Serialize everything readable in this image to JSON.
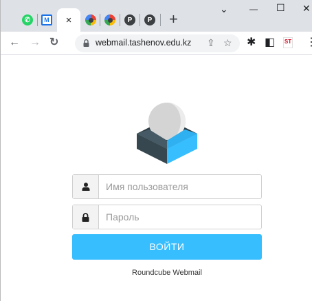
{
  "browser": {
    "tabs": [
      {
        "icon": "whatsapp-icon",
        "glyph": "✆"
      },
      {
        "icon": "mail-icon",
        "glyph": "M",
        "active": false
      },
      {
        "icon": "close-tab-icon",
        "glyph": "×",
        "active": true
      },
      {
        "icon": "round-favicon-icon",
        "glyph": ""
      },
      {
        "icon": "round-favicon-icon",
        "glyph": ""
      },
      {
        "icon": "p-favicon-icon",
        "glyph": "P"
      },
      {
        "icon": "p-favicon-icon",
        "glyph": "P"
      }
    ],
    "new_tab_glyph": "+",
    "window_controls": {
      "dropdown": "⌄",
      "minimize": "—",
      "maximize": "☐",
      "close": "✕"
    },
    "toolbar": {
      "back": "←",
      "forward": "→",
      "reload": "↻",
      "url": "webmail.tashenov.edu.kz",
      "share": "⇪",
      "bookmark": "☆",
      "extensions": "✱",
      "sidepanel": "◧",
      "profile_badge": "ST",
      "menu": "⋮"
    }
  },
  "login": {
    "username_placeholder": "Имя пользователя",
    "password_placeholder": "Пароль",
    "submit_label": "ВОЙТИ",
    "footer": "Roundcube Webmail"
  },
  "colors": {
    "accent": "#37beff",
    "logo_dark": "#37474f",
    "logo_blue": "#37beff",
    "logo_ball": "#d9d9d9"
  }
}
